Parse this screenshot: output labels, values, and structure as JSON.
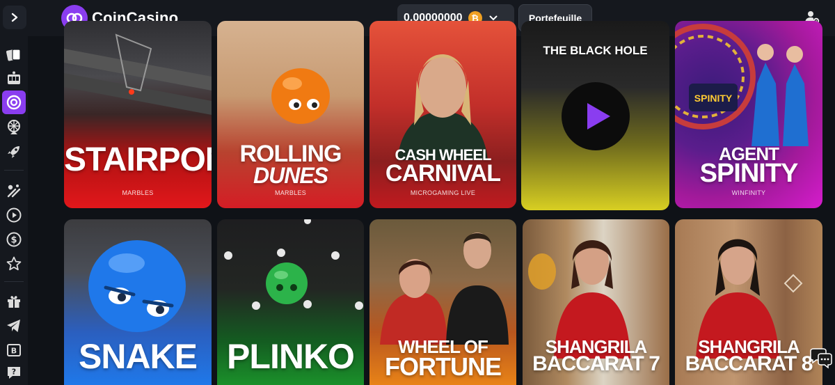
{
  "brand": {
    "name": "CoinCasino"
  },
  "header": {
    "balance": "0.00000000",
    "currency_symbol": "₿",
    "wallet_label": "Portefeuille"
  },
  "colors": {
    "accent": "#8a3df0",
    "btc": "#f0a022",
    "bg": "#0f1217"
  },
  "sidebar": {
    "items": [
      {
        "icon": "cards-icon"
      },
      {
        "icon": "slot-machine-icon"
      },
      {
        "icon": "roulette-icon",
        "active": true
      },
      {
        "icon": "wheel-icon"
      },
      {
        "icon": "rocket-icon"
      },
      {
        "icon": "sports-icon"
      },
      {
        "icon": "play-icon"
      },
      {
        "icon": "dollar-icon"
      },
      {
        "icon": "star-icon"
      },
      {
        "icon": "gift-icon"
      },
      {
        "icon": "telegram-icon"
      },
      {
        "icon": "bitcoin-card-icon"
      },
      {
        "icon": "help-icon"
      }
    ]
  },
  "games": [
    {
      "title1": "STAIRPONG",
      "title2": "",
      "provider": "MARBLES"
    },
    {
      "title1": "ROLLING",
      "title2": "DUNES",
      "provider": "MARBLES"
    },
    {
      "title1": "CASH WHEEL",
      "title2": "CARNIVAL",
      "provider": "MICROGAMING LIVE"
    },
    {
      "title1": "THE BLACK HOLE",
      "title2": "",
      "provider": ""
    },
    {
      "title1": "AGENT",
      "title2": "SPINITY",
      "provider": "WINFINITY"
    },
    {
      "title1": "SNAKE",
      "title2": "",
      "provider": ""
    },
    {
      "title1": "PLINKO",
      "title2": "",
      "provider": ""
    },
    {
      "title1": "WHEEL OF",
      "title2": "FORTUNE",
      "provider": ""
    },
    {
      "title1": "SHANGRILA",
      "title2": "BACCARAT 7",
      "provider": ""
    },
    {
      "title1": "SHANGRILA",
      "title2": "BACCARAT 8",
      "provider": ""
    }
  ]
}
